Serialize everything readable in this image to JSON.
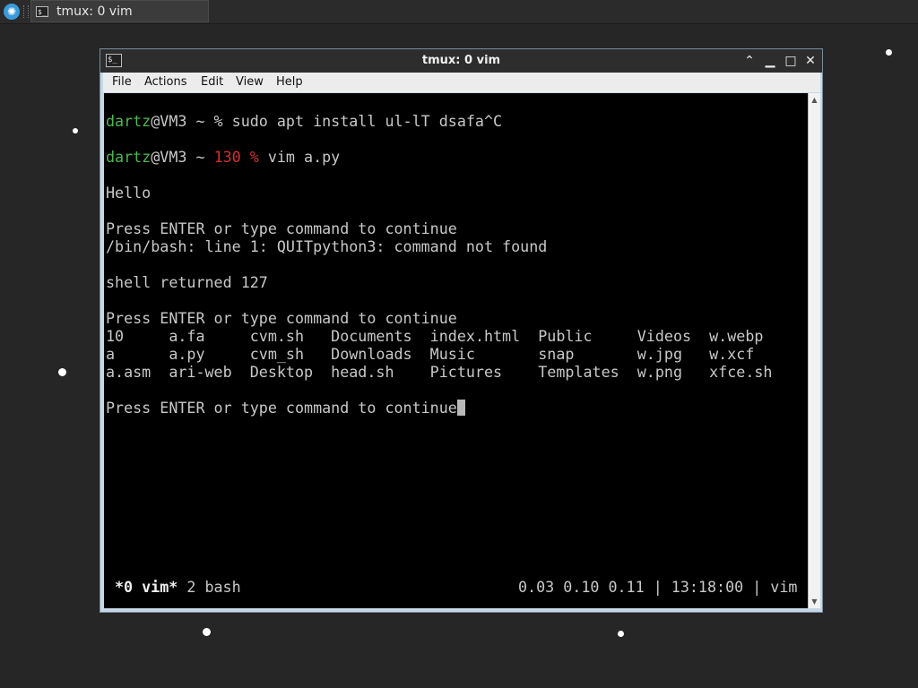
{
  "taskbar": {
    "start_icon": "fan-logo-icon",
    "task": {
      "icon": "terminal-icon",
      "label": "tmux: 0 vim"
    }
  },
  "window": {
    "title": "tmux: 0 vim",
    "controls": [
      "minimize",
      "restore",
      "maximize",
      "close"
    ],
    "menu": [
      "File",
      "Actions",
      "Edit",
      "View",
      "Help"
    ]
  },
  "terminal": {
    "line1": {
      "user": "dartz",
      "host": "@VM3 ~ % ",
      "cmd": "sudo apt install ul-lT dsafa^C"
    },
    "line2": {
      "user": "dartz",
      "host": "@VM3 ~ ",
      "code": "130 %",
      "cmd": " vim a.py"
    },
    "hello": "Hello",
    "press1": "Press ENTER or type command to continue",
    "error": "/bin/bash: line 1: QUITpython3: command not found",
    "shell_returned": "shell returned 127",
    "press2": "Press ENTER or type command to continue",
    "ls_row1": "10     a.fa     cvm.sh   Documents  index.html  Public     Videos  w.webp",
    "ls_row2": "a      a.py     cvm_sh   Downloads  Music       snap       w.jpg   w.xcf",
    "ls_row3": "a.asm  ari-web  Desktop  head.sh    Pictures    Templates  w.png   xfce.sh",
    "press3": "Press ENTER or type command to continue"
  },
  "status": {
    "active_window": "*0 vim*",
    "other_window": " 2 bash",
    "right": "0.03 0.10 0.11 | 13:18:00 | vim"
  }
}
